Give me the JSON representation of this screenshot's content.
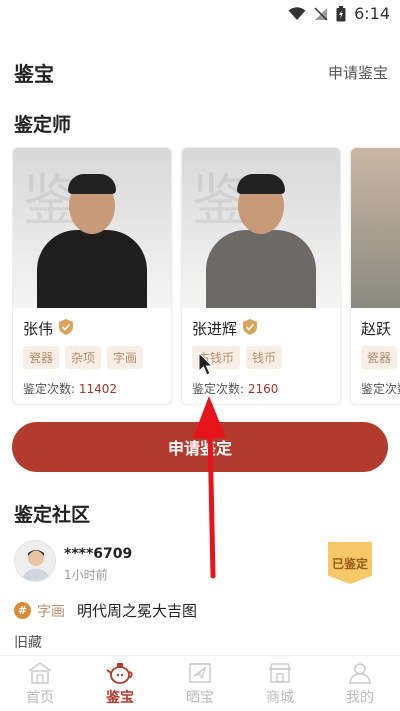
{
  "status_bar": {
    "time": "6:14"
  },
  "header": {
    "title": "鉴宝",
    "apply_link": "申请鉴宝"
  },
  "experts_section": {
    "title": "鉴定师",
    "experts": [
      {
        "name": "张伟",
        "tags": [
          "瓷器",
          "杂项",
          "字画"
        ],
        "count_label": "鉴定次数:",
        "count": "11402"
      },
      {
        "name": "张进辉",
        "tags": [
          "古钱币",
          "钱币"
        ],
        "count_label": "鉴定次数:",
        "count": "2160"
      },
      {
        "name": "赵跃",
        "tags": [
          "瓷器"
        ],
        "count_label": "鉴定次数",
        "count": ""
      }
    ]
  },
  "apply_button": {
    "label": "申请鉴定"
  },
  "community": {
    "title": "鉴定社区",
    "post": {
      "user": "****6709",
      "time": "1小时前",
      "badge": "已鉴定",
      "category": "字画",
      "title": "明代周之冕大吉图",
      "subtitle": "旧藏"
    }
  },
  "tabbar": {
    "tabs": [
      {
        "label": "首页",
        "icon": "home-icon",
        "active": false
      },
      {
        "label": "鉴宝",
        "icon": "teapot-icon",
        "active": true
      },
      {
        "label": "晒宝",
        "icon": "share-icon",
        "active": false
      },
      {
        "label": "商城",
        "icon": "shop-icon",
        "active": false
      },
      {
        "label": "我的",
        "icon": "profile-icon",
        "active": false
      }
    ]
  },
  "colors": {
    "accent": "#b23b2e",
    "tag_text": "#b98d69",
    "tag_bg": "#f7efe6",
    "badge": "#f6c86a"
  }
}
